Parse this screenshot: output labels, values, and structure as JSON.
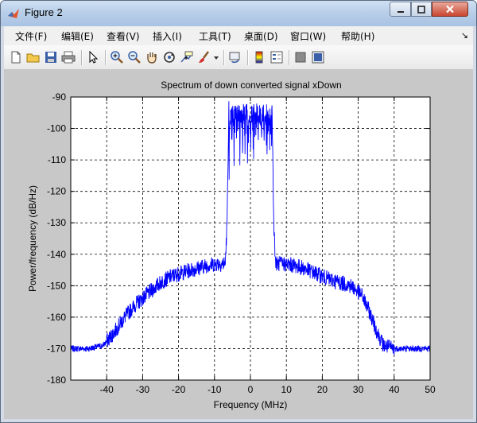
{
  "window": {
    "title": "Figure 2",
    "controls": {
      "minimize": "minimize",
      "maximize": "maximize",
      "close": "close"
    }
  },
  "menu": {
    "items": [
      "文件(F)",
      "编辑(E)",
      "查看(V)",
      "插入(I)",
      "工具(T)",
      "桌面(D)",
      "窗口(W)",
      "帮助(H)"
    ],
    "overflow_glyph": "↘"
  },
  "toolbar": {
    "icons": [
      "new-figure-icon",
      "open-file-icon",
      "save-icon",
      "print-icon",
      "pointer-icon",
      "zoom-in-icon",
      "zoom-out-icon",
      "pan-hand-icon",
      "rotate-3d-icon",
      "data-cursor-icon",
      "brush-icon",
      "link-plot-icon",
      "colorbar-icon",
      "legend-icon",
      "hide-plot-tools-icon",
      "show-plot-tools-icon"
    ]
  },
  "chart_data": {
    "type": "line",
    "title": "Spectrum of down converted signal xDown",
    "xlabel": "Frequency (MHz)",
    "ylabel": "Power/frequency (dB/Hz)",
    "xlim": [
      -50,
      50
    ],
    "ylim": [
      -180,
      -90
    ],
    "xticks": [
      -40,
      -30,
      -20,
      -10,
      0,
      10,
      20,
      30,
      40,
      50
    ],
    "yticks": [
      -90,
      -100,
      -110,
      -120,
      -130,
      -140,
      -150,
      -160,
      -170,
      -180
    ],
    "grid": true,
    "line_color": "#0000ff",
    "series": [
      {
        "x": [
          -50,
          -45,
          -41,
          -38,
          -35,
          -32,
          -28,
          -25,
          -22,
          -18,
          -15,
          -12,
          -9,
          -7,
          -6.5,
          -6,
          -4,
          -2,
          0,
          2,
          4,
          6,
          6.5,
          7,
          9,
          12,
          15,
          18,
          22,
          25,
          28,
          31,
          33,
          35,
          37,
          40,
          45,
          50
        ],
        "y": [
          -170,
          -170,
          -169,
          -165,
          -160,
          -156,
          -152,
          -149,
          -147,
          -145.5,
          -144.5,
          -143.5,
          -143,
          -143,
          -130,
          -93,
          -92,
          -92,
          -92,
          -92,
          -92,
          -93,
          -130,
          -143,
          -143,
          -143.5,
          -144.5,
          -146,
          -148,
          -149,
          -150,
          -153,
          -158,
          -164,
          -169,
          -170,
          -170,
          -170
        ]
      }
    ]
  }
}
